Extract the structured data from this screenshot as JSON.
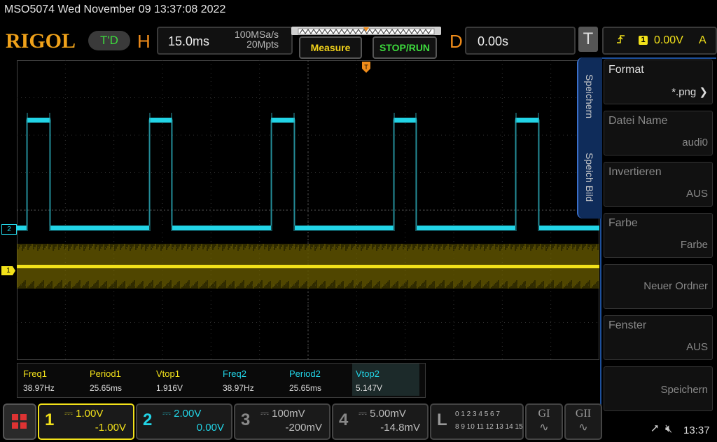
{
  "title": "MSO5074  Wed November 09 13:37:08 2022",
  "brand": "RIGOL",
  "trigger_status": "T'D",
  "horizontal": {
    "letter": "H",
    "timebase": "15.0ms",
    "sample_rate": "100MSa/s",
    "memory_depth": "20Mpts"
  },
  "buttons": {
    "measure": "Measure",
    "stop_run": "STOP/RUN"
  },
  "delay": {
    "letter": "D",
    "value": "0.00s"
  },
  "trigger": {
    "letter": "T",
    "source": "1",
    "level": "0.00V",
    "mode": "A"
  },
  "markers": {
    "ch2": "2",
    "ch1": "1"
  },
  "measurements": [
    {
      "label": "Freq1",
      "value": "38.97Hz",
      "color": "#f2e11a"
    },
    {
      "label": "Period1",
      "value": "25.65ms",
      "color": "#f2e11a"
    },
    {
      "label": "Vtop1",
      "value": "1.916V",
      "color": "#f2e11a"
    },
    {
      "label": "Freq2",
      "value": "38.97Hz",
      "color": "#22d4e6"
    },
    {
      "label": "Period2",
      "value": "25.65ms",
      "color": "#22d4e6"
    },
    {
      "label": "Vtop2",
      "value": "5.147V",
      "color": "#22d4e6"
    }
  ],
  "side_tabs": {
    "save": "Speichern",
    "save_image": "Speich Bild"
  },
  "menu": [
    {
      "label": "Format",
      "value": "*.png"
    },
    {
      "label": "Datei Name",
      "value": "audi0"
    },
    {
      "label": "Invertieren",
      "value": "AUS"
    },
    {
      "label": "Farbe",
      "value": "Farbe"
    },
    {
      "label": "",
      "value": "Neuer Ordner"
    },
    {
      "label": "Fenster",
      "value": "AUS"
    },
    {
      "label": "",
      "value": "Speichern"
    }
  ],
  "channels": [
    {
      "num": "1",
      "scale": "1.00V",
      "offset": "-1.00V",
      "color": "#f2e11a"
    },
    {
      "num": "2",
      "scale": "2.00V",
      "offset": "0.00V",
      "color": "#22d4e6"
    },
    {
      "num": "3",
      "scale": "100mV",
      "offset": "-200mV",
      "color": "#888888"
    },
    {
      "num": "4",
      "scale": "5.00mV",
      "offset": "-14.8mV",
      "color": "#888888"
    }
  ],
  "logic": {
    "letter": "L",
    "row1": "0 1 2 3  4 5 6 7",
    "row2": "8 9 10 11  12 13 14 15"
  },
  "decoders": {
    "g1": "GI",
    "g2": "GII"
  },
  "status": {
    "time": "13:37"
  },
  "colors": {
    "ch1": "#f2e11a",
    "ch2": "#22d4e6",
    "accent": "#f08c1a"
  }
}
